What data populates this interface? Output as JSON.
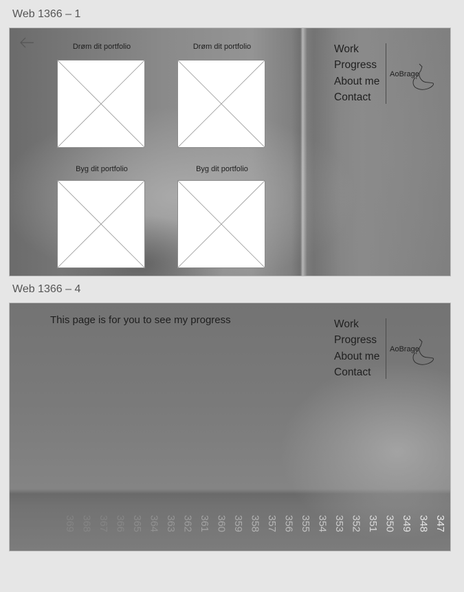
{
  "artboards": [
    {
      "title": "Web 1366 – 1",
      "back_icon": "arrow-left-icon",
      "tiles": [
        {
          "label": "Drøm dit portfolio"
        },
        {
          "label": "Drøm dit portfolio"
        },
        {
          "label": "Byg dit portfolio"
        },
        {
          "label": "Byg dit portfolio"
        }
      ]
    },
    {
      "title": "Web 1366 – 4",
      "intro": "This page is for you to see my progress",
      "ruler_numbers": [
        "347",
        "348",
        "349",
        "350",
        "351",
        "352",
        "353",
        "354",
        "355",
        "356",
        "357",
        "358",
        "359",
        "360",
        "361",
        "362",
        "363",
        "364",
        "365",
        "366",
        "367",
        "368",
        "369"
      ]
    }
  ],
  "nav": {
    "items": [
      "Work",
      "Progress",
      "About me",
      "Contact"
    ]
  },
  "logo": {
    "text": "AoBrage",
    "icon": "bird-logo-icon"
  },
  "colors": {
    "canvas": "#e6e6e6",
    "text": "#202020",
    "placeholder": "#ffffff"
  }
}
